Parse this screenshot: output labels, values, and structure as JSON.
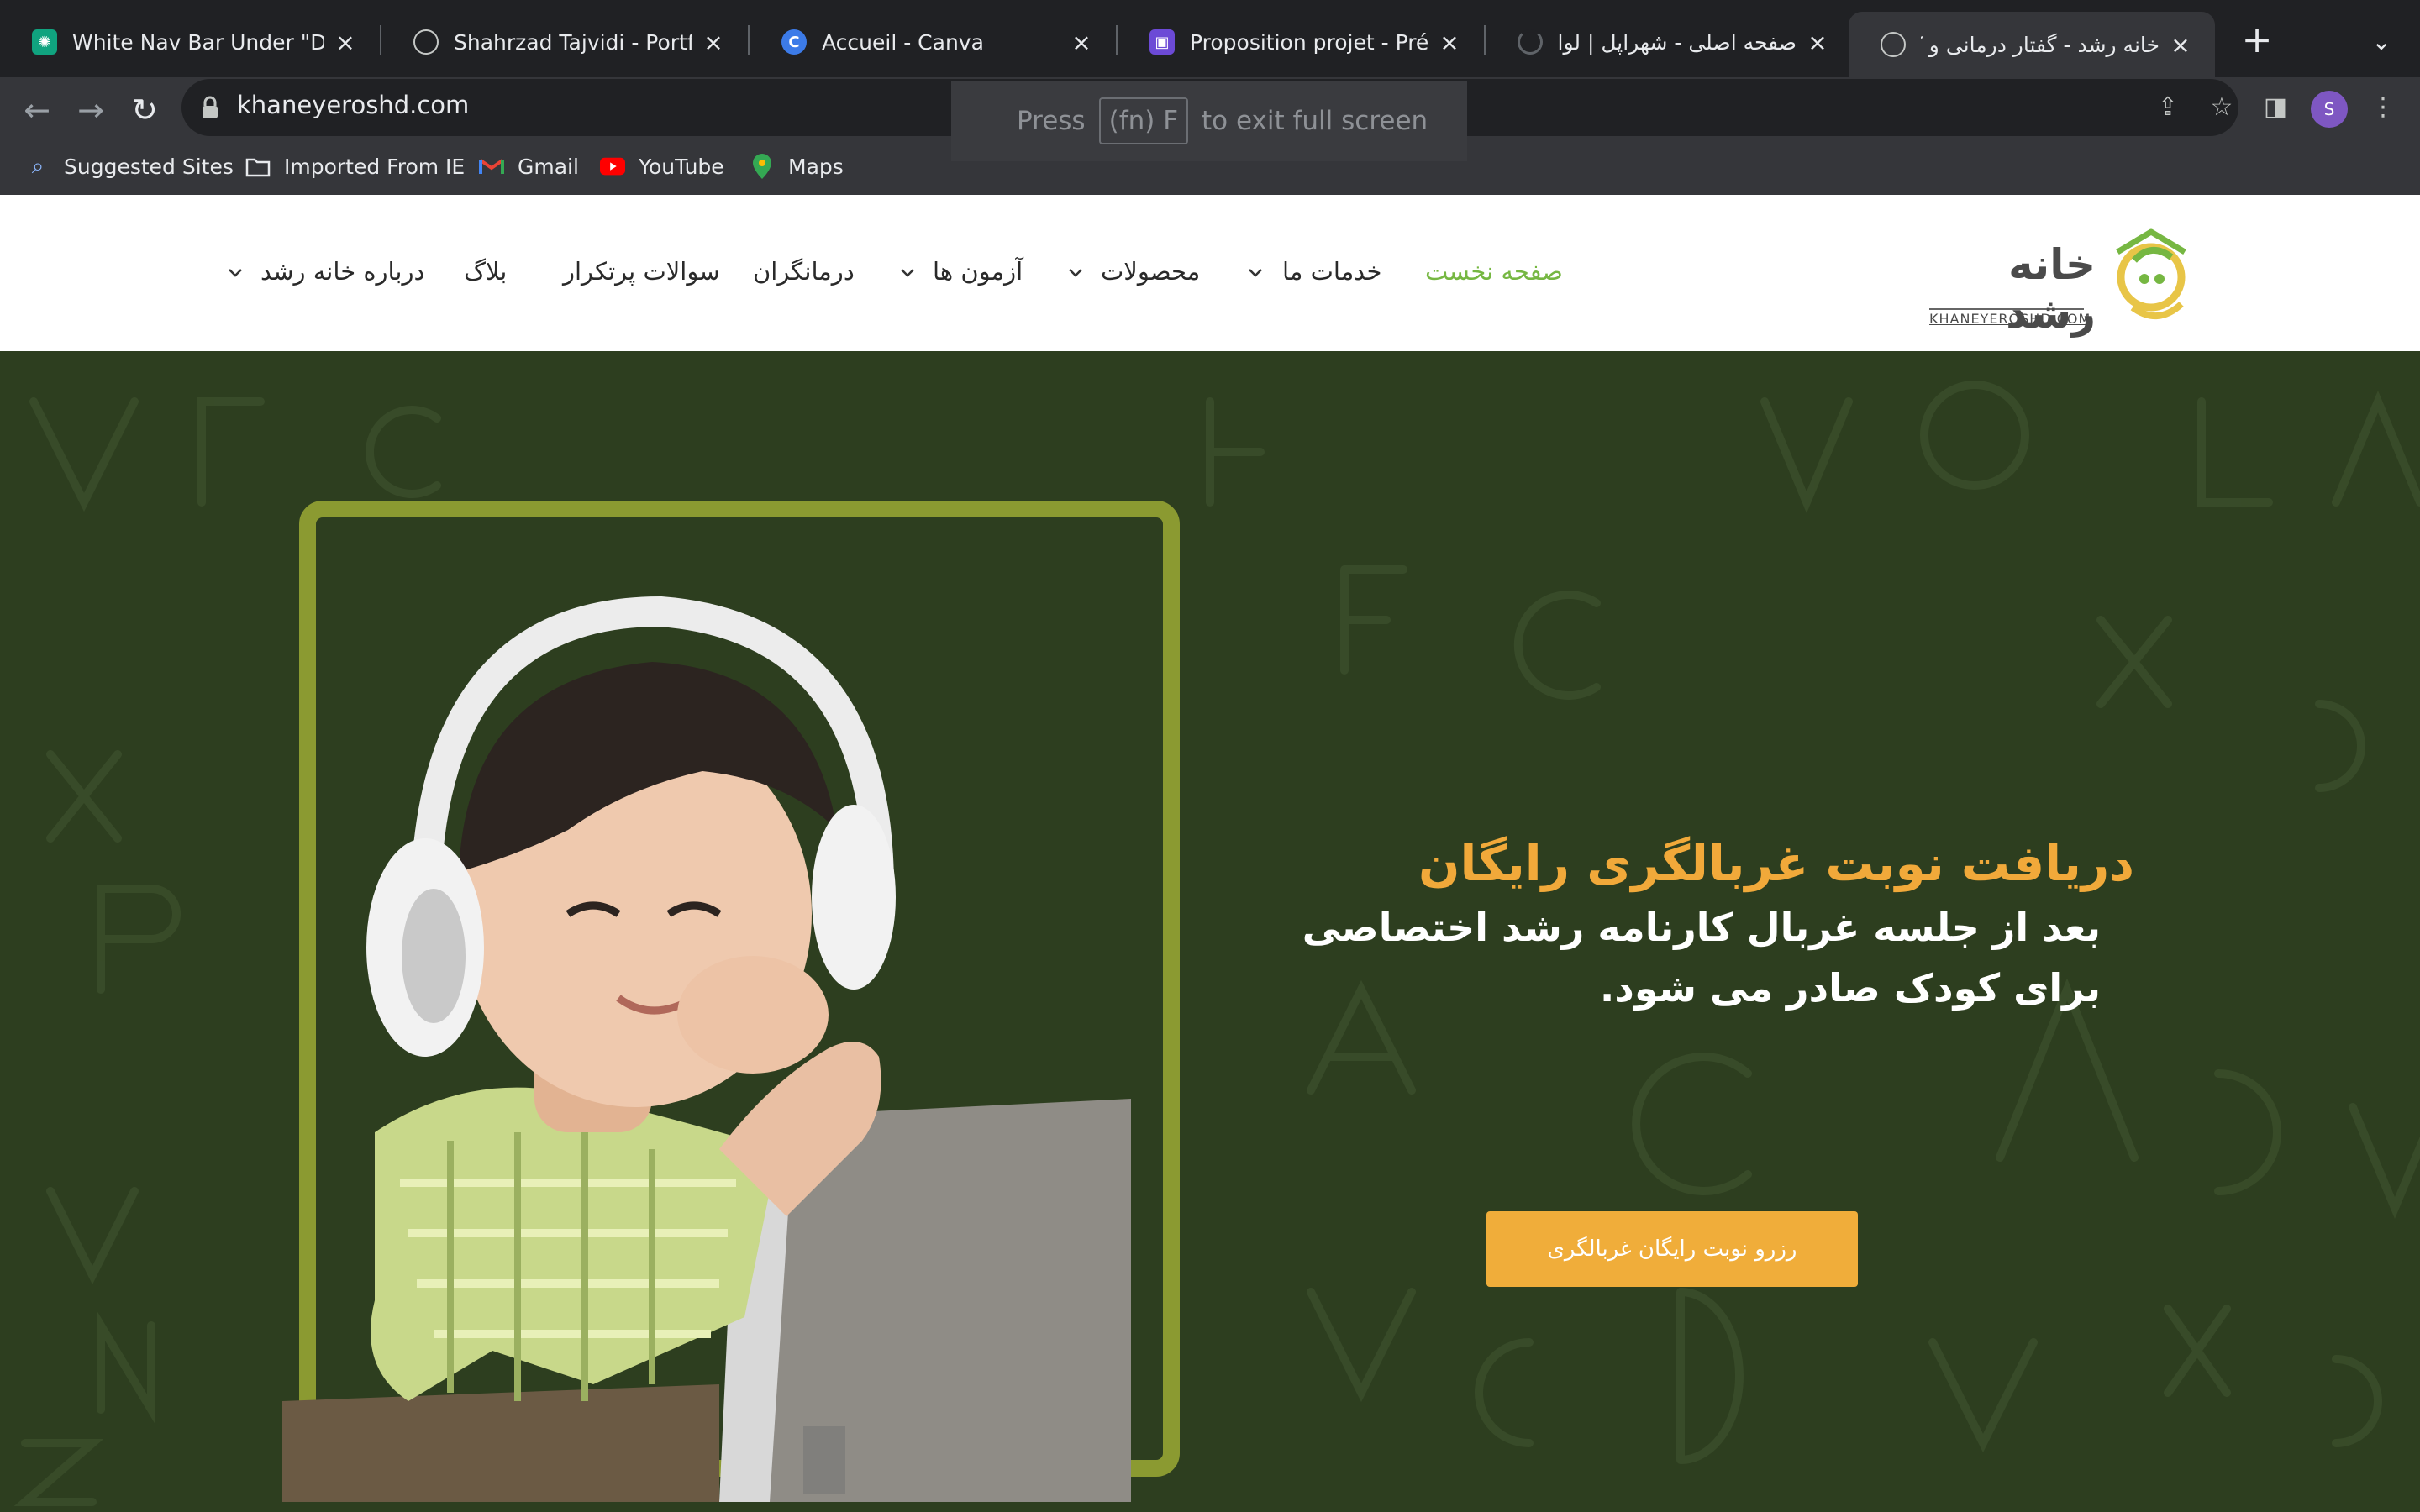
{
  "browser": {
    "tabs": [
      {
        "title": "White Nav Bar Under \"Déve",
        "icon": "chatgpt-icon"
      },
      {
        "title": "Shahrzad Tajvidi - Portfolio",
        "icon": "globe-icon"
      },
      {
        "title": "Accueil - Canva",
        "icon": "canva-icon"
      },
      {
        "title": "Proposition projet - Présent",
        "icon": "presentation-icon"
      },
      {
        "title": "صفحه اصلی - شهراپل | لوازم جان",
        "icon": "loading-icon"
      },
      {
        "title": "خانه رشد - گفتار درمانی و کاردرمانی",
        "icon": "globe-icon"
      }
    ],
    "new_tab_label": "+",
    "url": "khaneyeroshd.com",
    "fullscreen_toast": {
      "press": "Press",
      "key": "(fn) F",
      "rest": "to exit full screen"
    },
    "bookmarks": [
      {
        "label": "Suggested Sites",
        "icon": "search-icon"
      },
      {
        "label": "Imported From IE",
        "icon": "folder-icon"
      },
      {
        "label": "Gmail",
        "icon": "gmail-icon"
      },
      {
        "label": "YouTube",
        "icon": "youtube-icon"
      },
      {
        "label": "Maps",
        "icon": "maps-icon"
      }
    ],
    "profile_initial": "S"
  },
  "site": {
    "logo_text": "خانه رشد",
    "logo_domain": "KHANEYEROSHD.COM",
    "nav": [
      {
        "label": "صفحه نخست",
        "active": true,
        "dropdown": false
      },
      {
        "label": "خدمات ما",
        "active": false,
        "dropdown": true
      },
      {
        "label": "محصولات",
        "active": false,
        "dropdown": true
      },
      {
        "label": "آزمون ها",
        "active": false,
        "dropdown": true
      },
      {
        "label": "درمانگران",
        "active": false,
        "dropdown": false
      },
      {
        "label": "سوالات پرتکرار",
        "active": false,
        "dropdown": false
      },
      {
        "label": "بلاگ",
        "active": false,
        "dropdown": false
      },
      {
        "label": "درباره خانه رشد",
        "active": false,
        "dropdown": true
      }
    ],
    "hero": {
      "headline": "دریافت نوبت غربالگری رایگان",
      "subline": "بعد از جلسه غربال کارنامه رشد اختصاصی برای کودک صادر می شود.",
      "cta_label": "رزرو نوبت رایگان غربالگری"
    }
  },
  "colors": {
    "accent_green": "#76b742",
    "hero_bg": "#2d3e1f",
    "headline_orange": "#f1a93a",
    "cta_orange": "#f0ad3a",
    "frame_olive": "#8b9a31"
  }
}
